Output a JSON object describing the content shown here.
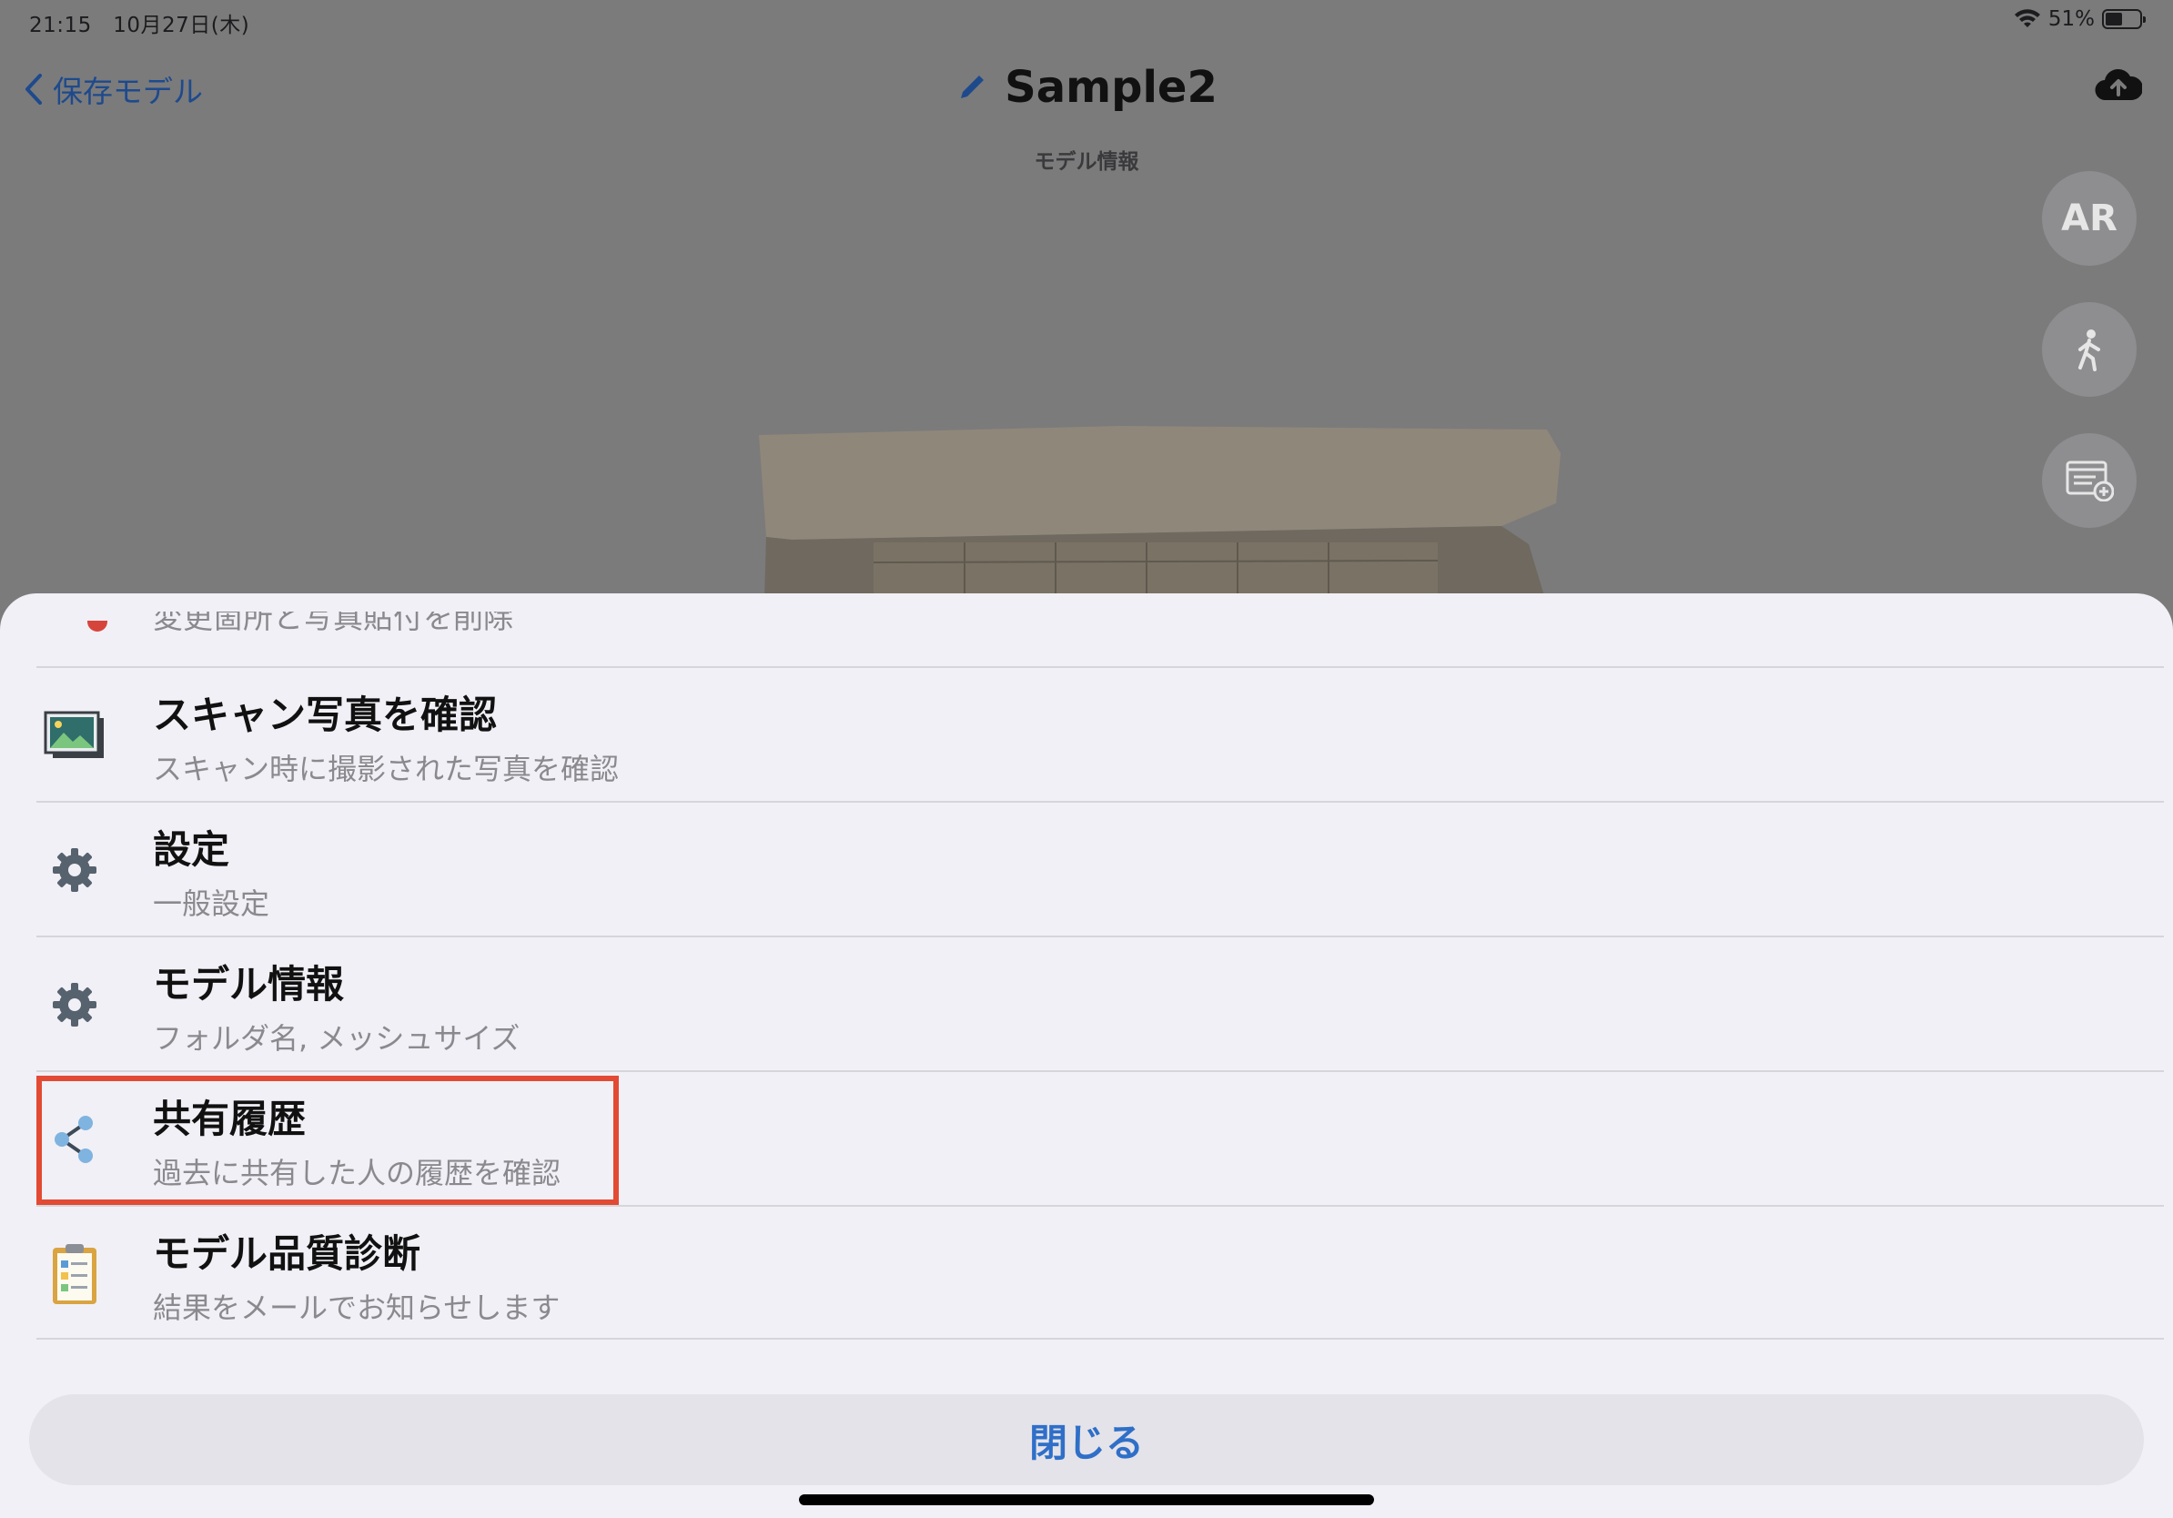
{
  "status_bar": {
    "time": "21:15",
    "date": "10月27日(木)",
    "battery": "51%"
  },
  "nav": {
    "back_label": "保存モデル",
    "title": "Sample2",
    "subtitle": "モデル情報"
  },
  "side_buttons": {
    "ar_label": "AR"
  },
  "sheet": {
    "partial_item": "変更箇所と写真貼付を削除",
    "items": [
      {
        "title": "スキャン写真を確認",
        "subtitle": "スキャン時に撮影された写真を確認",
        "icon": "photo-icon"
      },
      {
        "title": "設定",
        "subtitle": "一般設定",
        "icon": "gear-icon"
      },
      {
        "title": "モデル情報",
        "subtitle": "フォルダ名, メッシュサイズ",
        "icon": "gear-icon"
      },
      {
        "title": "共有履歴",
        "subtitle": "過去に共有した人の履歴を確認",
        "icon": "share-icon"
      },
      {
        "title": "モデル品質診断",
        "subtitle": "結果をメールでお知らせします",
        "icon": "clipboard-icon"
      }
    ],
    "close_label": "閉じる"
  },
  "colors": {
    "accent": "#2f6fc8",
    "highlight": "#e24a33",
    "dim_background": "#7b7b7c"
  }
}
